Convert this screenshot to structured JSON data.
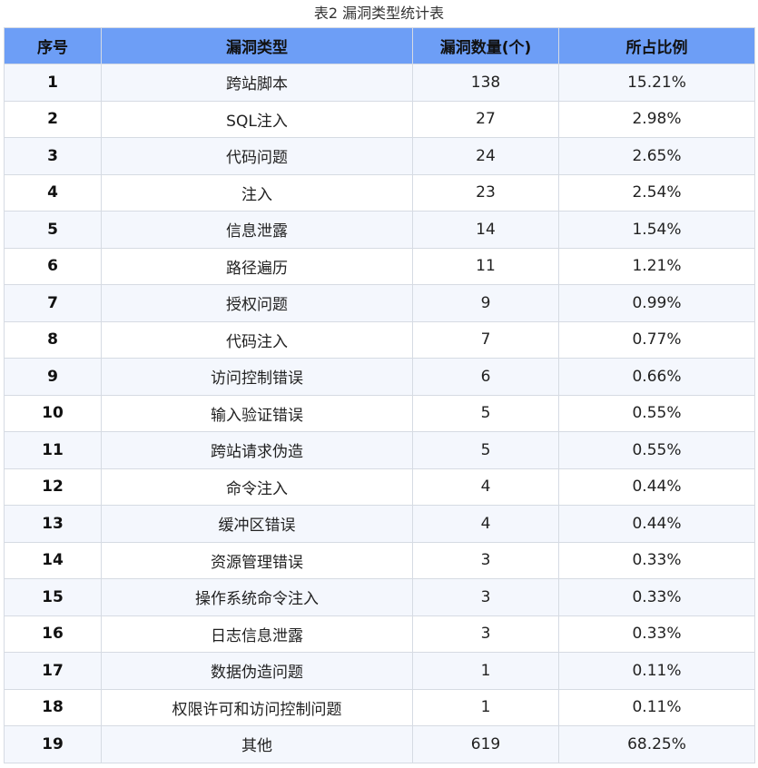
{
  "caption": "表2 漏洞类型统计表",
  "columns": [
    "序号",
    "漏洞类型",
    "漏洞数量(个)",
    "所占比例"
  ],
  "rows": [
    {
      "idx": "1",
      "type": "跨站脚本",
      "count": "138",
      "pct": "15.21%"
    },
    {
      "idx": "2",
      "type": "SQL注入",
      "count": "27",
      "pct": "2.98%"
    },
    {
      "idx": "3",
      "type": "代码问题",
      "count": "24",
      "pct": "2.65%"
    },
    {
      "idx": "4",
      "type": "注入",
      "count": "23",
      "pct": "2.54%"
    },
    {
      "idx": "5",
      "type": "信息泄露",
      "count": "14",
      "pct": "1.54%"
    },
    {
      "idx": "6",
      "type": "路径遍历",
      "count": "11",
      "pct": "1.21%"
    },
    {
      "idx": "7",
      "type": "授权问题",
      "count": "9",
      "pct": "0.99%"
    },
    {
      "idx": "8",
      "type": "代码注入",
      "count": "7",
      "pct": "0.77%"
    },
    {
      "idx": "9",
      "type": "访问控制错误",
      "count": "6",
      "pct": "0.66%"
    },
    {
      "idx": "10",
      "type": "输入验证错误",
      "count": "5",
      "pct": "0.55%"
    },
    {
      "idx": "11",
      "type": "跨站请求伪造",
      "count": "5",
      "pct": "0.55%"
    },
    {
      "idx": "12",
      "type": "命令注入",
      "count": "4",
      "pct": "0.44%"
    },
    {
      "idx": "13",
      "type": "缓冲区错误",
      "count": "4",
      "pct": "0.44%"
    },
    {
      "idx": "14",
      "type": "资源管理错误",
      "count": "3",
      "pct": "0.33%"
    },
    {
      "idx": "15",
      "type": "操作系统命令注入",
      "count": "3",
      "pct": "0.33%"
    },
    {
      "idx": "16",
      "type": "日志信息泄露",
      "count": "3",
      "pct": "0.33%"
    },
    {
      "idx": "17",
      "type": "数据伪造问题",
      "count": "1",
      "pct": "0.11%"
    },
    {
      "idx": "18",
      "type": "权限许可和访问控制问题",
      "count": "1",
      "pct": "0.11%"
    },
    {
      "idx": "19",
      "type": "其他",
      "count": "619",
      "pct": "68.25%"
    }
  ],
  "colors": {
    "header_bg": "#6d9ef6",
    "row_alt_bg": "#f4f7fd",
    "border": "#d6dbe3"
  }
}
